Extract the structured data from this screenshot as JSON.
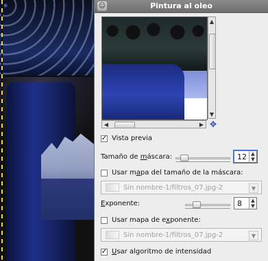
{
  "window": {
    "title": "Pintura al oleo",
    "app_icon": "gimp-icon"
  },
  "preview": {
    "checkbox_label": "Vista previa",
    "checked": true
  },
  "mask_size": {
    "label_prefix": "Tamaño de ",
    "label_mnemonic": "m",
    "label_suffix": "áscara:",
    "slider_level": 0.1,
    "value": "12"
  },
  "mask_map": {
    "checkbox_label_prefix": "Usar m",
    "checkbox_label_mnemonic": "a",
    "checkbox_label_suffix": "pa del tamaño de la máscara:",
    "checked": false,
    "combo_value": "Sin nombre-1/filtros_07.jpg-2"
  },
  "exponent": {
    "label_mnemonic": "E",
    "label_suffix": "xponente:",
    "slider_level": 0.2,
    "value": "8"
  },
  "exponent_map": {
    "checkbox_label_prefix": "Usar mapa de e",
    "checkbox_label_mnemonic": "x",
    "checkbox_label_suffix": "ponente:",
    "checked": false,
    "combo_value": "Sin nombre-1/filtros_07.jpg-2"
  },
  "intensity": {
    "checkbox_label_prefix": "",
    "checkbox_label_mnemonic": "U",
    "checkbox_label_suffix": "sar algoritmo de intensidad",
    "checked": true
  },
  "icons": {
    "navigate": "move-icon",
    "combo_image": "image-icon",
    "combo_caret": "chevron-down-icon"
  }
}
